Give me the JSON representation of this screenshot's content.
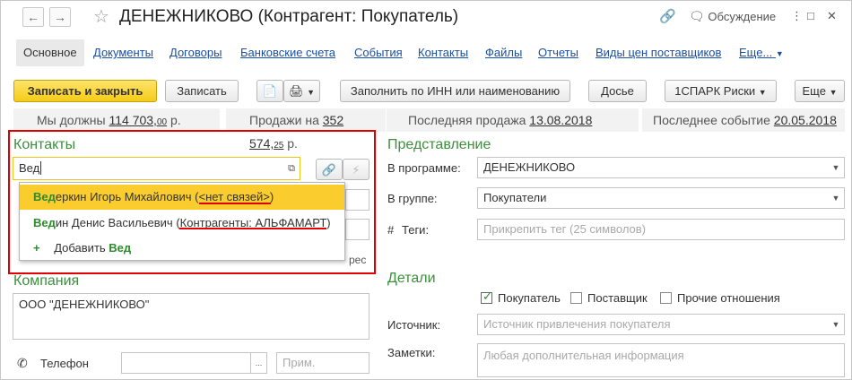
{
  "window": {
    "title": "ДЕНЕЖНИКОВО (Контрагент: Покупатель)",
    "discussion_label": "Обсуждение"
  },
  "tabs": [
    "Основное",
    "Документы",
    "Договоры",
    "Банковские счета",
    "События",
    "Контакты",
    "Файлы",
    "Отчеты",
    "Виды цен поставщиков",
    "Еще..."
  ],
  "toolbar": {
    "save_close": "Записать и закрыть",
    "save": "Записать",
    "fill_inn": "Заполнить по ИНН или наименованию",
    "dossier": "Досье",
    "spark": "1СПАРК Риски",
    "more": "Еще"
  },
  "stats": {
    "we_owe_label": "Мы должны",
    "we_owe_value": "114 703,",
    "we_owe_kop": "00",
    "we_owe_unit": "р.",
    "sales_label": "Продажи на",
    "sales_value": "352 574,",
    "sales_kop": "25",
    "sales_unit": "р.",
    "last_sale_label": "Последняя продажа",
    "last_sale_date": "13.08.2018",
    "last_event_label": "Последнее событие",
    "last_event_date": "20.05.2018"
  },
  "contacts": {
    "heading": "Контакты",
    "search_value": "Вед",
    "popup": [
      {
        "match": "Вед",
        "rest": "еркин Игорь Михайлович (",
        "tag": "<нет связей>",
        "close": ")"
      },
      {
        "match": "Вед",
        "rest": "ин Денис Васильевич (",
        "tag": "Контрагенты: АЛЬФАМАРТ",
        "close": ")"
      }
    ],
    "add_label": "Добавить",
    "add_value": "Вед",
    "address_suffix": "рес"
  },
  "company": {
    "heading": "Компания",
    "name": "ООО \"ДЕНЕЖНИКОВО\"",
    "phone_label": "Телефон",
    "phone_ellipsis": "...",
    "phone_note_placeholder": "Прим."
  },
  "representation": {
    "heading": "Представление",
    "program_label": "В программе:",
    "program_value": "ДЕНЕЖНИКОВО",
    "group_label": "В группе:",
    "group_value": "Покупатели",
    "tags_label": "Теги:",
    "tags_placeholder": "Прикрепить тег (25 символов)"
  },
  "details": {
    "heading": "Детали",
    "buyer_label": "Покупатель",
    "buyer_checked": true,
    "supplier_label": "Поставщик",
    "other_label": "Прочие отношения",
    "source_label": "Источник:",
    "source_placeholder": "Источник привлечения покупателя",
    "notes_label": "Заметки:",
    "notes_placeholder": "Любая дополнительная информация"
  },
  "colors": {
    "accent_yellow": "#f5cb17",
    "highlight_red": "#e00000",
    "section_green": "#3d8f3d",
    "link_blue": "#1a4fa6"
  }
}
